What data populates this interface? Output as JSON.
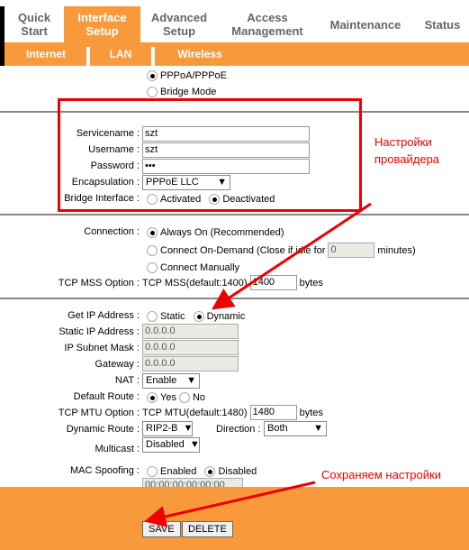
{
  "nav": {
    "tabs": [
      "Quick Start",
      "Interface Setup",
      "Advanced Setup",
      "Access Management",
      "Maintenance",
      "Status"
    ],
    "active": "Interface Setup",
    "subtabs": [
      "Internet",
      "LAN",
      "Wireless"
    ]
  },
  "encap_mode": {
    "opt1": "PPPoA/PPPoE",
    "opt2": "Bridge Mode",
    "selected": "PPPoA/PPPoE"
  },
  "pppoe": {
    "servicename_label": "Servicename :",
    "servicename": "szt",
    "username_label": "Username :",
    "username": "szt",
    "password_label": "Password :",
    "password": "•••",
    "encapsulation_label": "Encapsulation :",
    "encapsulation": "PPPoE LLC",
    "bridge_label": "Bridge Interface :",
    "bridge_activated": "Activated",
    "bridge_deactivated": "Deactivated"
  },
  "connection": {
    "label": "Connection :",
    "always_on": "Always On (Recommended)",
    "on_demand": "Connect On-Demand (Close if idle for",
    "idle_value": "0",
    "minutes": "minutes)",
    "manual": "Connect Manually",
    "tcp_mss_label": "TCP MSS Option :",
    "tcp_mss_text": "TCP MSS(default:1400)",
    "tcp_mss_value": "1400",
    "bytes": "bytes"
  },
  "ip": {
    "get_ip_label": "Get IP Address :",
    "static": "Static",
    "dynamic": "Dynamic",
    "static_ip_label": "Static IP Address :",
    "static_ip": "0.0.0.0",
    "subnet_label": "IP Subnet Mask :",
    "subnet": "0.0.0.0",
    "gateway_label": "Gateway :",
    "gateway": "0.0.0.0",
    "nat_label": "NAT :",
    "nat": "Enable",
    "default_route_label": "Default Route :",
    "yes": "Yes",
    "no": "No",
    "tcp_mtu_label": "TCP MTU Option :",
    "tcp_mtu_text": "TCP MTU(default:1480)",
    "tcp_mtu_value": "1480",
    "bytes": "bytes",
    "dynamic_route_label": "Dynamic Route :",
    "dynamic_route": "RIP2-B",
    "direction_label": "Direction :",
    "direction": "Both",
    "multicast_label": "Multicast :",
    "multicast": "Disabled",
    "mac_label": "MAC Spoofing :",
    "mac_enabled": "Enabled",
    "mac_disabled": "Disabled",
    "mac_value": "00:00:00:00:00:00"
  },
  "buttons": {
    "save": "SAVE",
    "delete": "DELETE"
  },
  "annotations": {
    "provider": "Настройки провайдера",
    "save": "Сохраняем настройки"
  },
  "colors": {
    "accent": "#f89a3c",
    "annotation": "#e00000"
  }
}
